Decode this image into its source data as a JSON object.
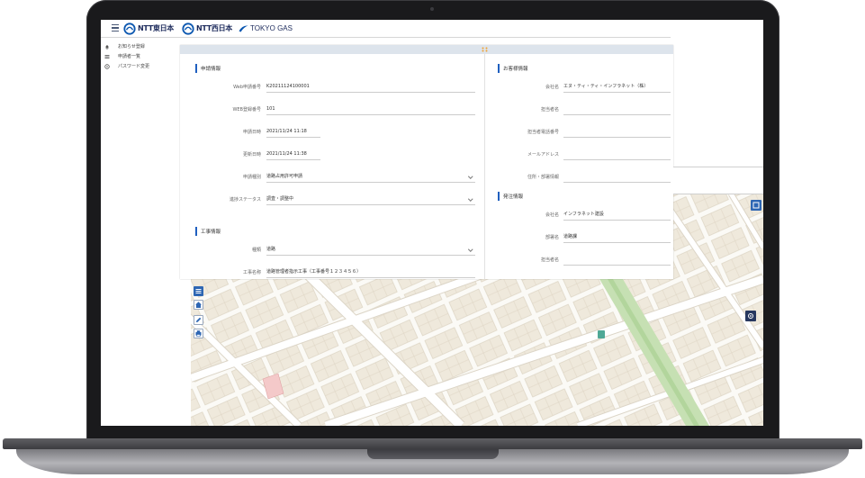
{
  "header": {
    "menu_icon": "hamburger-icon",
    "logo_ntt_east": "NTT東日本",
    "logo_ntt_west": "NTT西日本",
    "logo_tokyo_gas": "TOKYO GAS"
  },
  "sidebar": {
    "items": [
      {
        "icon": "bell-icon",
        "label": "お知らせ登録"
      },
      {
        "icon": "list-icon",
        "label": "申請者一覧"
      },
      {
        "icon": "lock-icon",
        "label": "パスワード変更"
      }
    ]
  },
  "modal": {
    "top_icon": "drag-handle-icon",
    "application": {
      "title": "申請情報",
      "fields": [
        {
          "label": "Web申請番号",
          "value": "K20211124100001"
        },
        {
          "label": "WEB登録番号",
          "value": "101"
        },
        {
          "label": "申請日時",
          "value": "2021/11/24 11:18"
        },
        {
          "label": "更新日時",
          "value": "2021/11/24 11:38"
        },
        {
          "label": "申請種別",
          "value": "道路占用許可申請"
        },
        {
          "label": "進捗ステータス",
          "value": "調査・調整中"
        }
      ]
    },
    "construction": {
      "title": "工事情報",
      "fields": [
        {
          "label": "種類",
          "value": "道路"
        },
        {
          "label": "工事名称",
          "value": "道路管理者指示工事（工事番号１２３４５６）"
        }
      ]
    },
    "customer": {
      "title": "お客様情報",
      "fields": [
        {
          "label": "会社名",
          "value": "エヌ・ティ・ティ・インフラネット（株）"
        },
        {
          "label": "担当者名",
          "value": ""
        },
        {
          "label": "担当者電話番号",
          "value": ""
        },
        {
          "label": "メールアドレス",
          "value": ""
        },
        {
          "label": "住所・部署情報",
          "value": ""
        }
      ]
    },
    "order": {
      "title": "発注情報",
      "fields": [
        {
          "label": "会社名",
          "value": "インフラネット建設"
        },
        {
          "label": "部署名",
          "value": "道路課"
        },
        {
          "label": "担当者名",
          "value": ""
        }
      ]
    }
  },
  "map": {
    "controls_left": [
      "layers-icon",
      "home-icon",
      "edit-icon",
      "print-icon"
    ],
    "controls_right": [
      "layers-icon",
      "locate-icon"
    ]
  },
  "colors": {
    "accent_blue": "#1f5fbf",
    "brand_navy": "#1d2b5c",
    "map_park_green": "#c6e0b3",
    "highlight_building": "#f4c9c9",
    "map_marker": "#4fa896",
    "drag_handle": "#f0a030"
  }
}
